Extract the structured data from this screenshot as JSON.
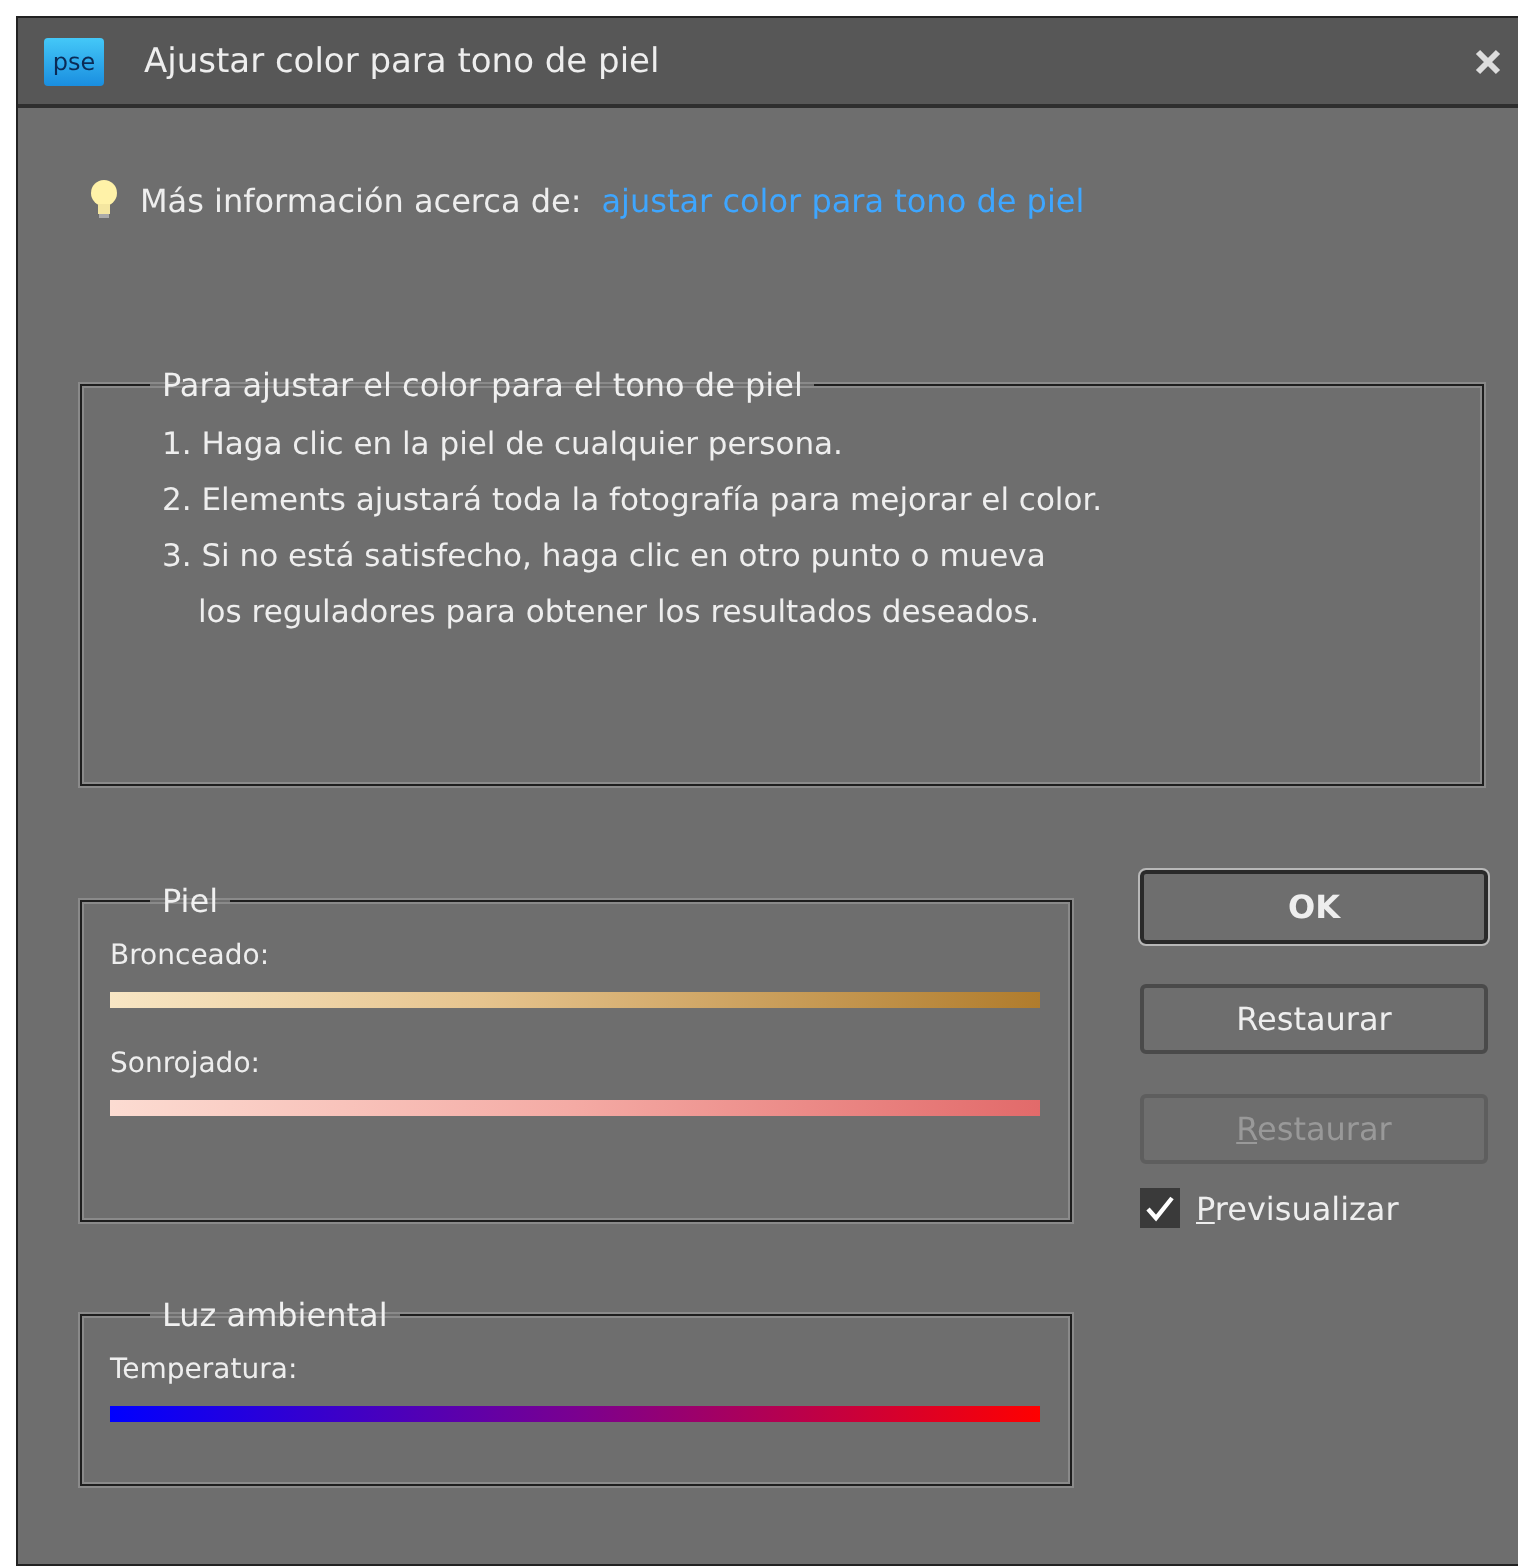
{
  "window": {
    "app_icon_text": "pse",
    "title": "Ajustar color para tono de piel"
  },
  "info": {
    "text": "Más información acerca de:",
    "link": "ajustar color para tono de piel"
  },
  "instructions": {
    "title": "Para ajustar el color para el tono de piel",
    "steps": [
      "1. Haga clic en la piel de cualquier persona.",
      "2. Elements ajustará toda la fotografía para mejorar el color.",
      "3. Si no está satisfecho, haga clic en otro punto o mueva\nlos reguladores para obtener los resultados deseados."
    ]
  },
  "groups": [
    {
      "title": "Piel",
      "sliders": [
        {
          "label": "Bronceado:",
          "kind": "tan"
        },
        {
          "label": "Sonrojado:",
          "kind": "blush"
        }
      ]
    },
    {
      "title": "Luz ambiental",
      "sliders": [
        {
          "label": "Temperatura:",
          "kind": "temperature"
        }
      ]
    }
  ],
  "buttons": [
    {
      "label": "OK",
      "default": true,
      "disabled": false,
      "mnemonic": false
    },
    {
      "label": "Restaurar",
      "default": false,
      "disabled": false,
      "mnemonic": false
    },
    {
      "label": "Restaurar",
      "default": false,
      "disabled": true,
      "mnemonic": true
    }
  ],
  "preview": {
    "label": "Previsualizar",
    "checked": true,
    "mnemonic": true
  }
}
